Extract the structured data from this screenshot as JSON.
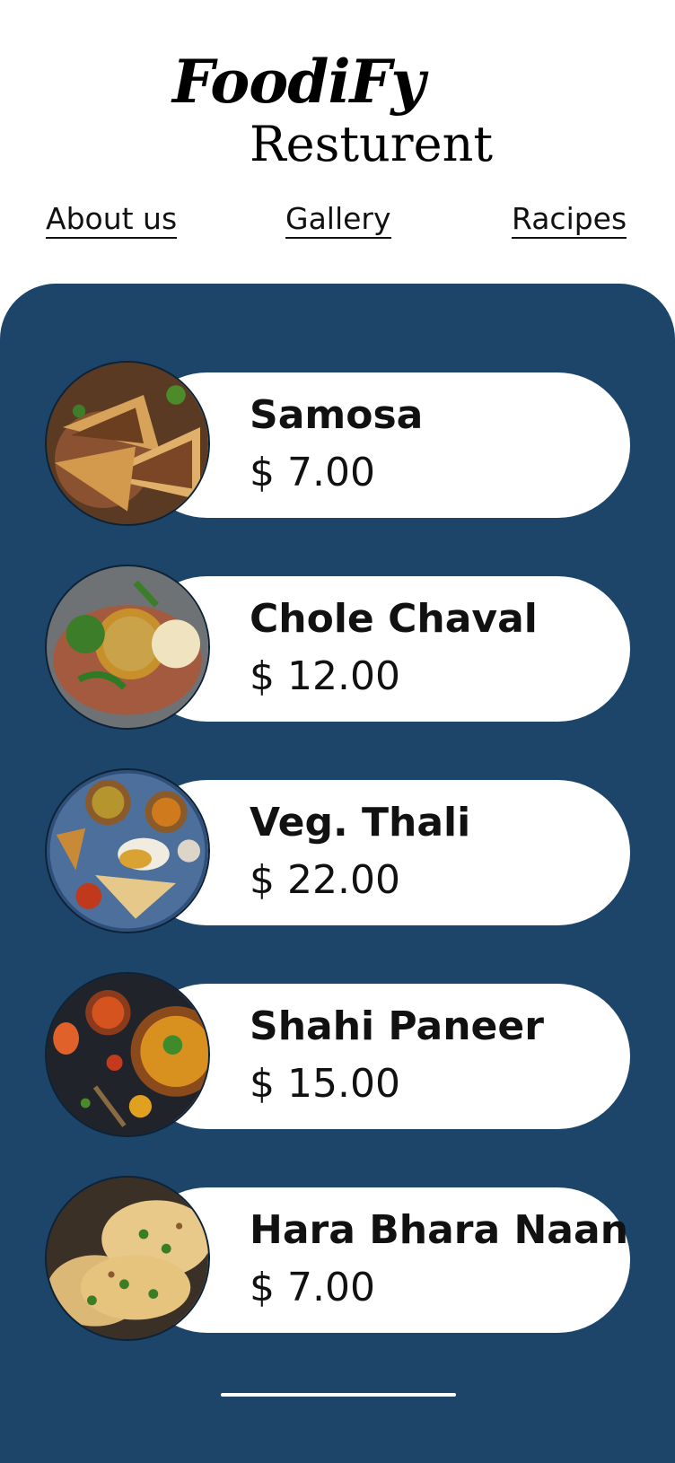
{
  "brand": {
    "name": "FoodiFy",
    "subtitle": "Resturent"
  },
  "nav": {
    "items": [
      {
        "label": "About us"
      },
      {
        "label": "Gallery"
      },
      {
        "label": "Racipes"
      }
    ]
  },
  "menu": {
    "items": [
      {
        "name": "Samosa",
        "price": "$ 7.00"
      },
      {
        "name": "Chole Chaval",
        "price": "$ 12.00"
      },
      {
        "name": "Veg. Thali",
        "price": "$ 22.00"
      },
      {
        "name": "Shahi Paneer",
        "price": "$ 15.00"
      },
      {
        "name": "Hara Bhara Naan",
        "price": "$ 7.00"
      }
    ]
  },
  "colors": {
    "panel": "#1c4569",
    "card": "#ffffff",
    "text": "#111111"
  }
}
